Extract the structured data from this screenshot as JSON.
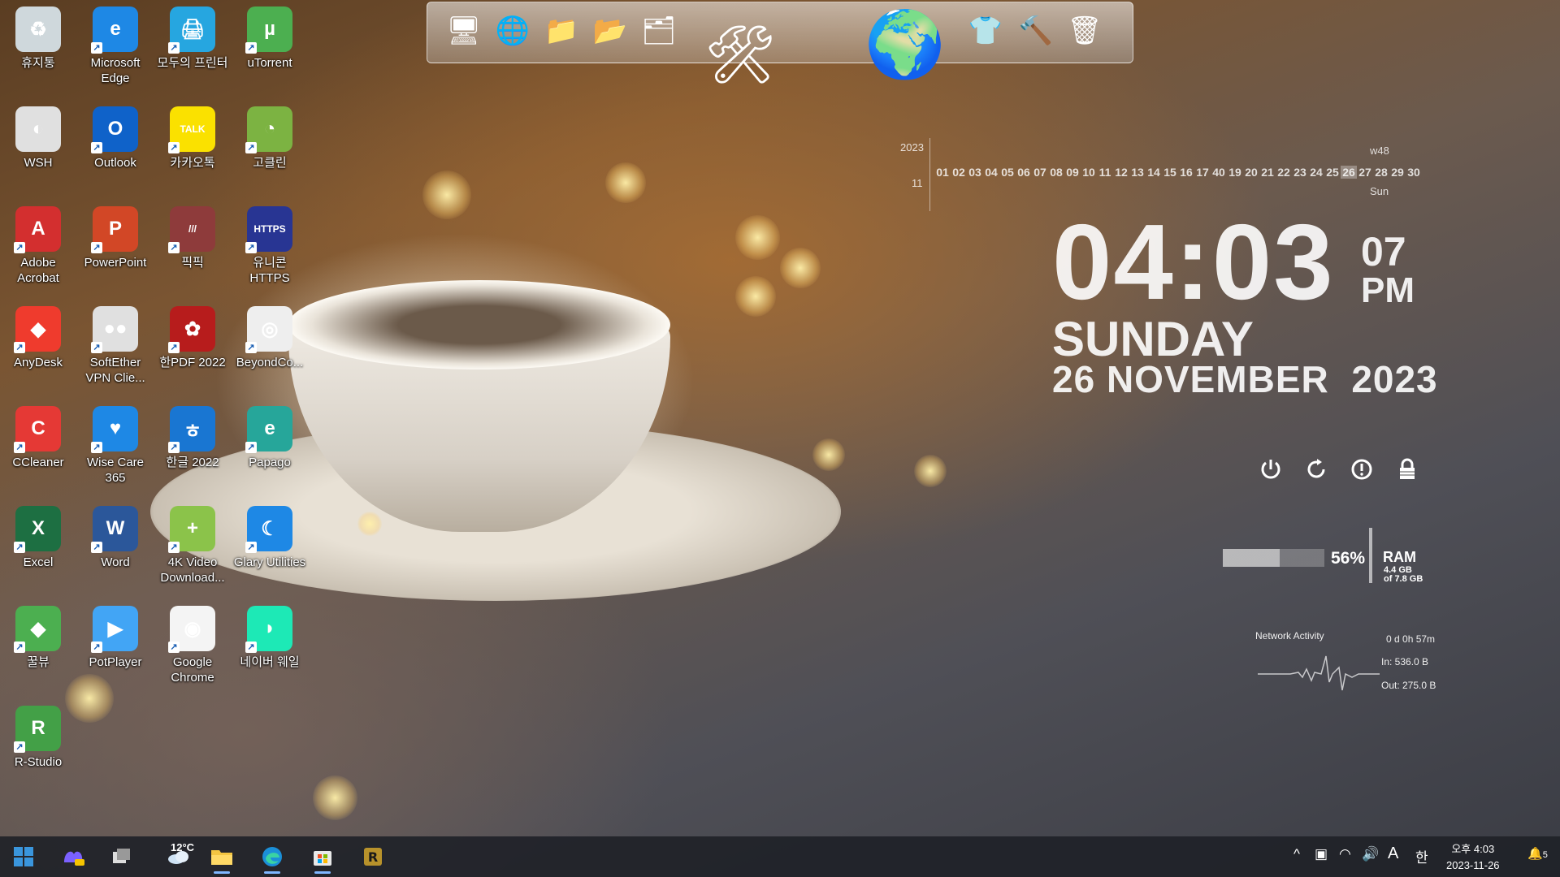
{
  "desktop_icons": [
    {
      "label": "휴지통",
      "glyph": "♻",
      "color": "#cfd8dc",
      "shortcut": false
    },
    {
      "label": "Microsoft Edge",
      "glyph": "e",
      "color": "#1e88e5",
      "shortcut": true
    },
    {
      "label": "모두의 프린터",
      "glyph": "🖨",
      "color": "#26a6e0",
      "shortcut": true
    },
    {
      "label": "uTorrent",
      "glyph": "µ",
      "color": "#4caf50",
      "shortcut": true
    },
    {
      "label": "WSH",
      "glyph": "◐",
      "color": "#e0e0e0",
      "shortcut": false
    },
    {
      "label": "Outlook",
      "glyph": "O",
      "color": "#0f62c9",
      "shortcut": true
    },
    {
      "label": "카카오톡",
      "glyph": "TALK",
      "color": "#fae100",
      "shortcut": true
    },
    {
      "label": "고클린",
      "glyph": "◔",
      "color": "#7cb342",
      "shortcut": true
    },
    {
      "label": "Adobe Acrobat",
      "glyph": "A",
      "color": "#d32f2f",
      "shortcut": true
    },
    {
      "label": "PowerPoint",
      "glyph": "P",
      "color": "#d24726",
      "shortcut": true
    },
    {
      "label": "픽픽",
      "glyph": "///",
      "color": "#8e3b3b",
      "shortcut": true
    },
    {
      "label": "유니콘 HTTPS",
      "glyph": "HTTPS",
      "color": "#283593",
      "shortcut": true
    },
    {
      "label": "AnyDesk",
      "glyph": "◆",
      "color": "#ef3b2d",
      "shortcut": true
    },
    {
      "label": "SoftEther VPN Clie...",
      "glyph": "●●",
      "color": "#e0e0e0",
      "shortcut": true
    },
    {
      "label": "한PDF 2022",
      "glyph": "✿",
      "color": "#b71c1c",
      "shortcut": true
    },
    {
      "label": "BeyondCo...",
      "glyph": "◎",
      "color": "#eeeeee",
      "shortcut": true
    },
    {
      "label": "CCleaner",
      "glyph": "C",
      "color": "#e53935",
      "shortcut": true
    },
    {
      "label": "Wise Care 365",
      "glyph": "♥",
      "color": "#1e88e5",
      "shortcut": true
    },
    {
      "label": "한글 2022",
      "glyph": "ㅎ",
      "color": "#1976d2",
      "shortcut": true
    },
    {
      "label": "Papago",
      "glyph": "e",
      "color": "#26a69a",
      "shortcut": true
    },
    {
      "label": "Excel",
      "glyph": "X",
      "color": "#1d6f42",
      "shortcut": true
    },
    {
      "label": "Word",
      "glyph": "W",
      "color": "#2b579a",
      "shortcut": true
    },
    {
      "label": "4K Video Download...",
      "glyph": "+",
      "color": "#8bc34a",
      "shortcut": true
    },
    {
      "label": "Glary Utilities",
      "glyph": "☾",
      "color": "#1e88e5",
      "shortcut": true
    },
    {
      "label": "꿀뷰",
      "glyph": "◆",
      "color": "#4caf50",
      "shortcut": true
    },
    {
      "label": "PotPlayer",
      "glyph": "▶",
      "color": "#42a5f5",
      "shortcut": true
    },
    {
      "label": "Google Chrome",
      "glyph": "◉",
      "color": "#f4f4f4",
      "shortcut": true
    },
    {
      "label": "네이버 웨일",
      "glyph": "◗",
      "color": "#1de9b6",
      "shortcut": true
    },
    {
      "label": "R-Studio",
      "glyph": "R",
      "color": "#43a047",
      "shortcut": true
    }
  ],
  "dock_items": [
    {
      "name": "computer",
      "glyph": "🖥"
    },
    {
      "name": "network",
      "glyph": "🌐"
    },
    {
      "name": "documents-folder",
      "glyph": "📁"
    },
    {
      "name": "pictures-folder",
      "glyph": "📂"
    },
    {
      "name": "drive",
      "glyph": "🗂"
    },
    {
      "name": "utilities",
      "glyph": "🛠"
    },
    {
      "name": "globe",
      "glyph": "🌍"
    },
    {
      "name": "themes",
      "glyph": "👕"
    },
    {
      "name": "tools",
      "glyph": "🔨"
    },
    {
      "name": "recycle-bin",
      "glyph": "🗑"
    }
  ],
  "calendar": {
    "year": "2023",
    "month": "11",
    "week": "w48",
    "day_name": "Sun",
    "today": "26",
    "days": [
      "01",
      "02",
      "03",
      "04",
      "05",
      "06",
      "07",
      "08",
      "09",
      "10",
      "11",
      "12",
      "13",
      "14",
      "15",
      "16",
      "17",
      "40",
      "19",
      "20",
      "21",
      "22",
      "23",
      "24",
      "25",
      "26",
      "27",
      "28",
      "29",
      "30"
    ]
  },
  "clock": {
    "hours": "04",
    "minutes": "03",
    "seconds": "07",
    "ampm": "PM",
    "day": "SUNDAY",
    "date": "26 NOVEMBER",
    "year": "2023"
  },
  "power_buttons": [
    "power-icon",
    "restart-icon",
    "shutdown-icon",
    "lock-icon"
  ],
  "ram": {
    "percent": "56%",
    "label": "RAM",
    "used": "4.4 GB",
    "total": "of 7.8 GB",
    "fraction": 0.56
  },
  "network": {
    "title": "Network Activity",
    "uptime": "0 d 0h 57m",
    "in": "In: 536.0 B",
    "out": "Out: 275.0 B"
  },
  "taskbar": {
    "weather_temp": "12°C",
    "tray_input_mode": "A",
    "tray_ime": "한",
    "time": "오후 4:03",
    "date": "2023-11-26",
    "notification_count": "5",
    "start_color": "#3a96dd"
  }
}
